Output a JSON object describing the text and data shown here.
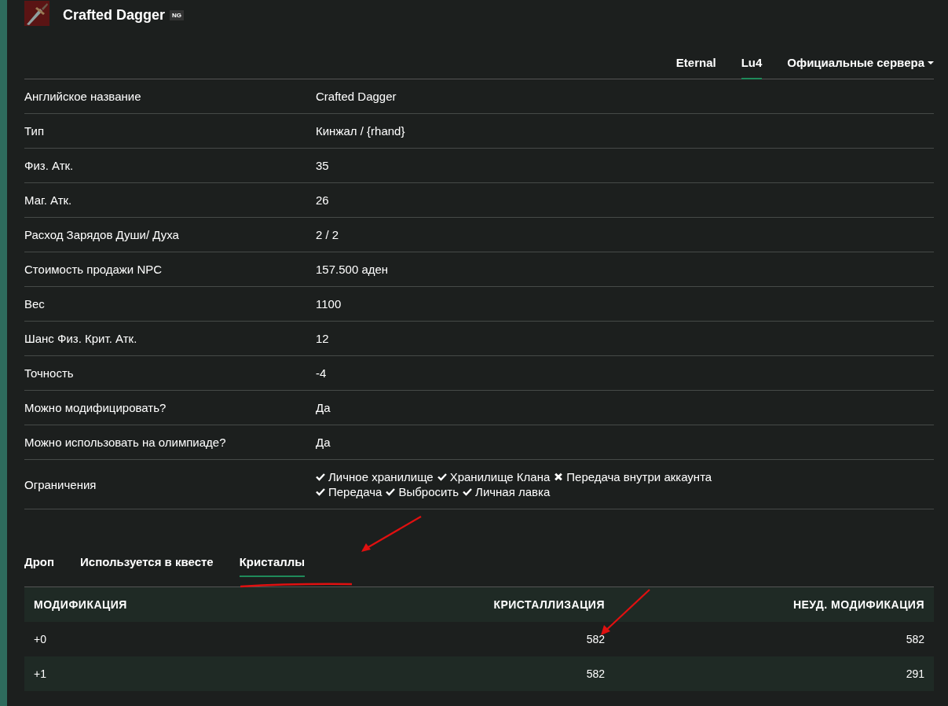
{
  "item": {
    "title": "Crafted Dagger",
    "grade": "NG"
  },
  "server_tabs": [
    {
      "label": "Eternal",
      "selected": false,
      "dropdown": false
    },
    {
      "label": "Lu4",
      "selected": true,
      "dropdown": false
    },
    {
      "label": "Официальные сервера",
      "selected": false,
      "dropdown": true
    }
  ],
  "properties": [
    {
      "label": "Английское название",
      "value": "Crafted Dagger"
    },
    {
      "label": "Тип",
      "value": "Кинжал / {rhand}"
    },
    {
      "label": "Физ. Атк.",
      "value": "35"
    },
    {
      "label": "Маг. Атк.",
      "value": "26"
    },
    {
      "label": "Расход Зарядов Души/ Духа",
      "value": "2 / 2"
    },
    {
      "label": "Стоимость продажи NPC",
      "value": "157.500 аден"
    },
    {
      "label": "Вес",
      "value": "1100"
    },
    {
      "label": "Шанс Физ. Крит. Атк.",
      "value": "12"
    },
    {
      "label": "Точность",
      "value": "-4"
    },
    {
      "label": "Можно модифицировать?",
      "value": "Да"
    },
    {
      "label": "Можно использовать на олимпиаде?",
      "value": "Да"
    }
  ],
  "restrictions": {
    "label": "Ограничения",
    "lines": [
      [
        {
          "label": "Личное хранилище",
          "allowed": true
        },
        {
          "label": "Хранилище Клана",
          "allowed": true
        },
        {
          "label": "Передача внутри аккаунта",
          "allowed": false
        }
      ],
      [
        {
          "label": "Передача",
          "allowed": true
        },
        {
          "label": "Выбросить",
          "allowed": true
        },
        {
          "label": "Личная лавка",
          "allowed": true
        }
      ]
    ]
  },
  "section_tabs": [
    {
      "label": "Дроп",
      "selected": false
    },
    {
      "label": "Используется в квесте",
      "selected": false
    },
    {
      "label": "Кристаллы",
      "selected": true
    }
  ],
  "crystals_table": {
    "columns": [
      "МОДИФИКАЦИЯ",
      "КРИСТАЛЛИЗАЦИЯ",
      "НЕУД. МОДИФИКАЦИЯ"
    ],
    "rows": [
      [
        "+0",
        "582",
        "582"
      ],
      [
        "+1",
        "582",
        "291"
      ]
    ]
  }
}
